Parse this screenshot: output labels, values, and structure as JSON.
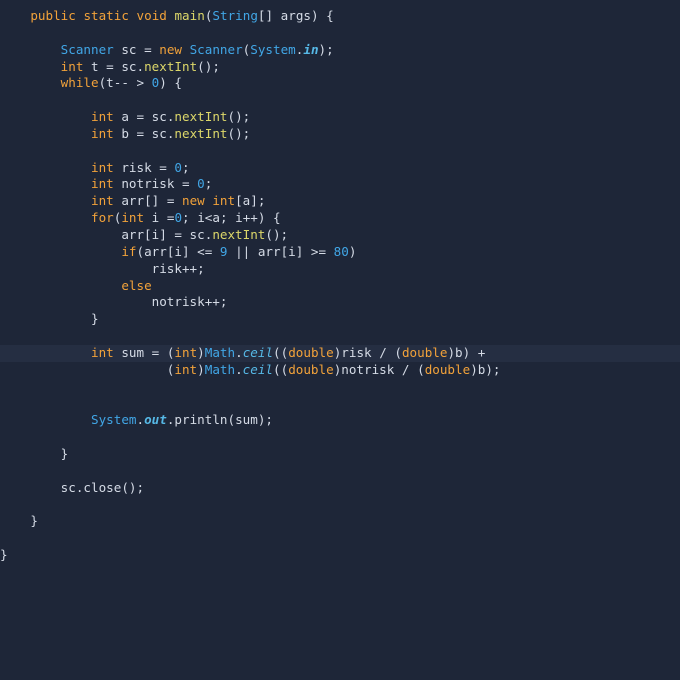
{
  "editor": {
    "current_line_index": 20,
    "token_colors": {
      "keyword": "#f2a23a",
      "class": "#41a6e6",
      "method": "#ddd86a",
      "number": "#41a6e6",
      "static_field": "#56b8e6",
      "text": "#d5dbe6",
      "background": "#1e2638",
      "current_line": "#252e42",
      "status_bar": "#3e5666"
    },
    "lines": [
      [
        {
          "t": "    ",
          "k": "txt"
        },
        {
          "t": "public",
          "k": "kw"
        },
        {
          "t": " ",
          "k": "txt"
        },
        {
          "t": "static",
          "k": "kw"
        },
        {
          "t": " ",
          "k": "txt"
        },
        {
          "t": "void",
          "k": "kw"
        },
        {
          "t": " ",
          "k": "txt"
        },
        {
          "t": "main",
          "k": "fn"
        },
        {
          "t": "(",
          "k": "op"
        },
        {
          "t": "String",
          "k": "cls"
        },
        {
          "t": "[] ",
          "k": "op"
        },
        {
          "t": "args",
          "k": "var"
        },
        {
          "t": ") {",
          "k": "op"
        }
      ],
      [],
      [
        {
          "t": "        ",
          "k": "txt"
        },
        {
          "t": "Scanner",
          "k": "cls"
        },
        {
          "t": " sc = ",
          "k": "txt"
        },
        {
          "t": "new",
          "k": "kw"
        },
        {
          "t": " ",
          "k": "txt"
        },
        {
          "t": "Scanner",
          "k": "cls"
        },
        {
          "t": "(",
          "k": "op"
        },
        {
          "t": "System",
          "k": "cls"
        },
        {
          "t": ".",
          "k": "op"
        },
        {
          "t": "in",
          "k": "sfld"
        },
        {
          "t": ");",
          "k": "op"
        }
      ],
      [
        {
          "t": "        ",
          "k": "txt"
        },
        {
          "t": "int",
          "k": "type"
        },
        {
          "t": " t = sc.",
          "k": "txt"
        },
        {
          "t": "nextInt",
          "k": "fn"
        },
        {
          "t": "();",
          "k": "op"
        }
      ],
      [
        {
          "t": "        ",
          "k": "txt"
        },
        {
          "t": "while",
          "k": "kw"
        },
        {
          "t": "(t-- > ",
          "k": "txt"
        },
        {
          "t": "0",
          "k": "num"
        },
        {
          "t": ") {",
          "k": "op"
        }
      ],
      [],
      [
        {
          "t": "            ",
          "k": "txt"
        },
        {
          "t": "int",
          "k": "type"
        },
        {
          "t": " a = sc.",
          "k": "txt"
        },
        {
          "t": "nextInt",
          "k": "fn"
        },
        {
          "t": "();",
          "k": "op"
        }
      ],
      [
        {
          "t": "            ",
          "k": "txt"
        },
        {
          "t": "int",
          "k": "type"
        },
        {
          "t": " b = sc.",
          "k": "txt"
        },
        {
          "t": "nextInt",
          "k": "fn"
        },
        {
          "t": "();",
          "k": "op"
        }
      ],
      [],
      [
        {
          "t": "            ",
          "k": "txt"
        },
        {
          "t": "int",
          "k": "type"
        },
        {
          "t": " risk = ",
          "k": "txt"
        },
        {
          "t": "0",
          "k": "num"
        },
        {
          "t": ";",
          "k": "op"
        }
      ],
      [
        {
          "t": "            ",
          "k": "txt"
        },
        {
          "t": "int",
          "k": "type"
        },
        {
          "t": " notrisk = ",
          "k": "txt"
        },
        {
          "t": "0",
          "k": "num"
        },
        {
          "t": ";",
          "k": "op"
        }
      ],
      [
        {
          "t": "            ",
          "k": "txt"
        },
        {
          "t": "int",
          "k": "type"
        },
        {
          "t": " arr[] = ",
          "k": "txt"
        },
        {
          "t": "new",
          "k": "kw"
        },
        {
          "t": " ",
          "k": "txt"
        },
        {
          "t": "int",
          "k": "type"
        },
        {
          "t": "[a];",
          "k": "txt"
        }
      ],
      [
        {
          "t": "            ",
          "k": "txt"
        },
        {
          "t": "for",
          "k": "kw"
        },
        {
          "t": "(",
          "k": "op"
        },
        {
          "t": "int",
          "k": "type"
        },
        {
          "t": " i =",
          "k": "txt"
        },
        {
          "t": "0",
          "k": "num"
        },
        {
          "t": "; i<a; i++) {",
          "k": "txt"
        }
      ],
      [
        {
          "t": "                arr[i] = sc.",
          "k": "txt"
        },
        {
          "t": "nextInt",
          "k": "fn"
        },
        {
          "t": "();",
          "k": "op"
        }
      ],
      [
        {
          "t": "                ",
          "k": "txt"
        },
        {
          "t": "if",
          "k": "kw"
        },
        {
          "t": "(arr[i] <= ",
          "k": "txt"
        },
        {
          "t": "9",
          "k": "num"
        },
        {
          "t": " || arr[i] >= ",
          "k": "txt"
        },
        {
          "t": "80",
          "k": "num"
        },
        {
          "t": ")",
          "k": "op"
        }
      ],
      [
        {
          "t": "                    risk++;",
          "k": "txt"
        }
      ],
      [
        {
          "t": "                ",
          "k": "txt"
        },
        {
          "t": "else",
          "k": "kw"
        }
      ],
      [
        {
          "t": "                    notrisk++;",
          "k": "txt"
        }
      ],
      [
        {
          "t": "            }",
          "k": "txt"
        }
      ],
      [],
      [
        {
          "t": "            ",
          "k": "txt"
        },
        {
          "t": "int",
          "k": "type"
        },
        {
          "t": " sum = ",
          "k": "txt"
        },
        {
          "t": "(",
          "k": "op"
        },
        {
          "t": "int",
          "k": "type"
        },
        {
          "t": ")",
          "k": "op"
        },
        {
          "t": "Math",
          "k": "cls"
        },
        {
          "t": ".",
          "k": "op"
        },
        {
          "t": "ceil",
          "k": "smeth"
        },
        {
          "t": "((",
          "k": "op"
        },
        {
          "t": "double",
          "k": "type"
        },
        {
          "t": ")risk / (",
          "k": "txt"
        },
        {
          "t": "double",
          "k": "type"
        },
        {
          "t": ")b) +",
          "k": "txt"
        }
      ],
      [
        {
          "t": "                      (",
          "k": "txt"
        },
        {
          "t": "int",
          "k": "type"
        },
        {
          "t": ")",
          "k": "op"
        },
        {
          "t": "Math",
          "k": "cls"
        },
        {
          "t": ".",
          "k": "op"
        },
        {
          "t": "ceil",
          "k": "smeth"
        },
        {
          "t": "((",
          "k": "op"
        },
        {
          "t": "double",
          "k": "type"
        },
        {
          "t": ")notrisk / (",
          "k": "txt"
        },
        {
          "t": "double",
          "k": "type"
        },
        {
          "t": ")b);",
          "k": "txt"
        }
      ],
      [],
      [],
      [
        {
          "t": "            ",
          "k": "txt"
        },
        {
          "t": "System",
          "k": "cls"
        },
        {
          "t": ".",
          "k": "op"
        },
        {
          "t": "out",
          "k": "sfld"
        },
        {
          "t": ".println(sum);",
          "k": "txt"
        }
      ],
      [],
      [
        {
          "t": "        }",
          "k": "txt"
        }
      ],
      [],
      [
        {
          "t": "        sc.close();",
          "k": "txt"
        }
      ],
      [],
      [
        {
          "t": "    }",
          "k": "txt"
        }
      ],
      [],
      [
        {
          "t": "}",
          "k": "txt"
        }
      ]
    ]
  }
}
